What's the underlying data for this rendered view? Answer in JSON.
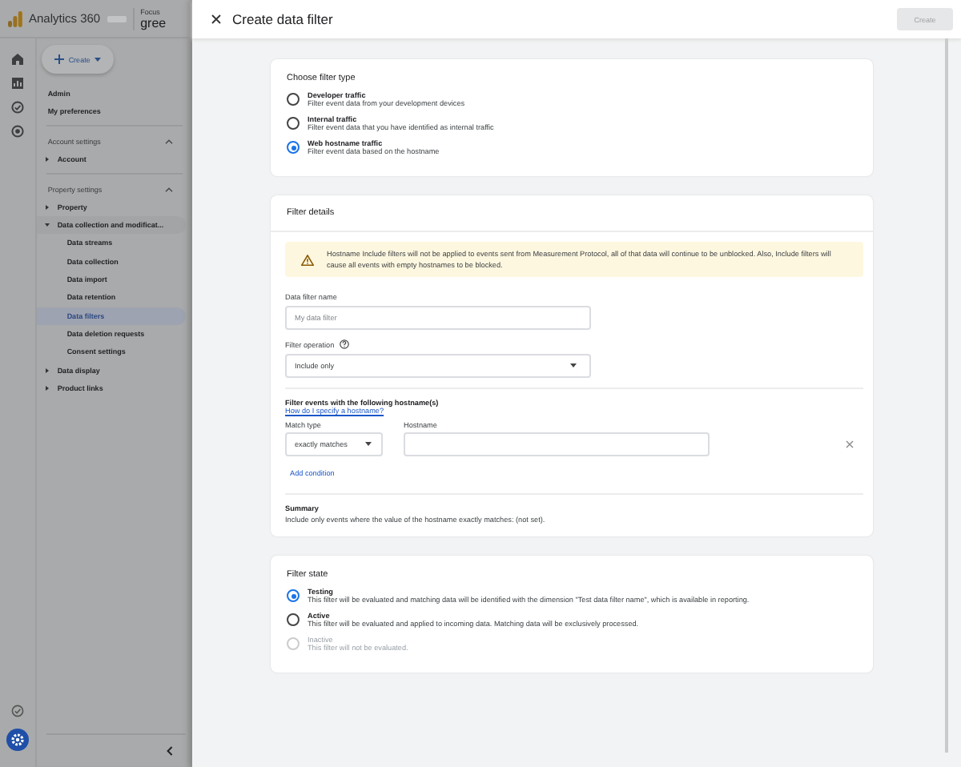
{
  "app": {
    "product": "Analytics 360",
    "focus_label": "Focus",
    "property": "gree"
  },
  "create_menu": {
    "label": "Create"
  },
  "nav": [
    {
      "kind": "link",
      "label": "Admin"
    },
    {
      "kind": "link",
      "label": "My preferences"
    },
    {
      "kind": "section",
      "label": "Account settings",
      "expanded": true,
      "children": [
        {
          "label": "Account",
          "expanded": false
        }
      ]
    },
    {
      "kind": "section",
      "label": "Property settings",
      "expanded": true,
      "children": [
        {
          "label": "Property",
          "expanded": false
        },
        {
          "label": "Data collection and modificat...",
          "expanded": true,
          "children": [
            {
              "label": "Data streams",
              "selected": false
            },
            {
              "label": "Data collection",
              "selected": false
            },
            {
              "label": "Data import",
              "selected": false
            },
            {
              "label": "Data retention",
              "selected": false
            },
            {
              "label": "Data filters",
              "selected": true
            },
            {
              "label": "Data deletion requests",
              "selected": false
            },
            {
              "label": "Consent settings",
              "selected": false
            }
          ]
        },
        {
          "label": "Data display",
          "expanded": false
        },
        {
          "label": "Product links",
          "expanded": false
        }
      ]
    }
  ],
  "dialog": {
    "title": "Create data filter",
    "create_button": {
      "label": "Create",
      "disabled": true
    }
  },
  "filter_type": {
    "title": "Choose filter type",
    "options": [
      {
        "label": "Developer traffic",
        "description": "Filter event data from your development devices",
        "selected": false,
        "disabled": false
      },
      {
        "label": "Internal traffic",
        "description": "Filter event data that you have identified as internal traffic",
        "selected": false,
        "disabled": false
      },
      {
        "label": "Web hostname traffic",
        "description": "Filter event data based on the hostname",
        "selected": true,
        "disabled": false
      }
    ]
  },
  "filter_details": {
    "title": "Filter details",
    "warning": "Hostname Include filters will not be applied to events sent from Measurement Protocol, all of that data will continue to be unblocked. Also, Include filters will cause all events with empty hostnames to be blocked.",
    "name_field": {
      "label": "Data filter name",
      "placeholder": "My data filter"
    },
    "operation": {
      "label": "Filter operation",
      "value": "Include only"
    },
    "hostnames": {
      "title": "Filter events with the following hostname(s)",
      "help_link": "How do I specify a hostname?",
      "match_type": {
        "label": "Match type",
        "value": "exactly matches"
      },
      "hostname": {
        "label": "Hostname"
      },
      "add_condition": "Add condition"
    },
    "summary": {
      "title": "Summary",
      "text": "Include only events where the value of the hostname exactly matches: (not set)."
    }
  },
  "filter_state": {
    "title": "Filter state",
    "options": [
      {
        "label": "Testing",
        "description": "This filter will be evaluated and matching data will be identified with the dimension \"Test data filter name\", which is available in reporting.",
        "selected": true,
        "disabled": false
      },
      {
        "label": "Active",
        "description": "This filter will be evaluated and applied to incoming data. Matching data will be exclusively processed.",
        "selected": false,
        "disabled": false
      },
      {
        "label": "Inactive",
        "description": "This filter will not be evaluated.",
        "selected": false,
        "disabled": true
      }
    ]
  }
}
